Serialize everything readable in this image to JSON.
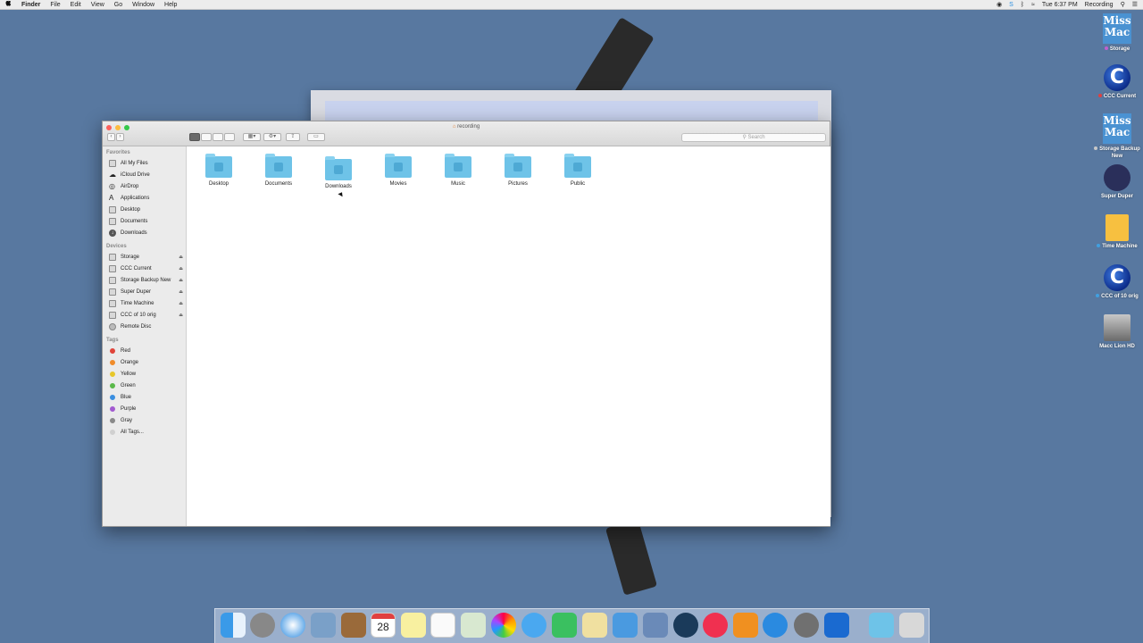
{
  "menubar": {
    "app_name": "Finder",
    "menus": [
      "File",
      "Edit",
      "View",
      "Go",
      "Window",
      "Help"
    ],
    "clock": "Tue 6:37 PM",
    "user": "Recording"
  },
  "window": {
    "title": "recording",
    "search_placeholder": "Search",
    "sidebar": {
      "favorites_header": "Favorites",
      "favorites": [
        "All My Files",
        "iCloud Drive",
        "AirDrop",
        "Applications",
        "Desktop",
        "Documents",
        "Downloads"
      ],
      "devices_header": "Devices",
      "devices": [
        "Storage",
        "CCC Current",
        "Storage Backup New",
        "Super Duper",
        "Time Machine",
        "CCC of 10 orig",
        "Remote Disc"
      ],
      "tags_header": "Tags",
      "tags": [
        {
          "label": "Red",
          "color": "#e0443a"
        },
        {
          "label": "Orange",
          "color": "#f08c2a"
        },
        {
          "label": "Yellow",
          "color": "#e7c72a"
        },
        {
          "label": "Green",
          "color": "#5ab84a"
        },
        {
          "label": "Blue",
          "color": "#3a8ee0"
        },
        {
          "label": "Purple",
          "color": "#a25ad0"
        },
        {
          "label": "Gray",
          "color": "#8a8a8a"
        },
        {
          "label": "All Tags...",
          "color": "#d0d0d0"
        }
      ]
    },
    "folders": [
      "Desktop",
      "Documents",
      "Downloads",
      "Movies",
      "Music",
      "Pictures",
      "Public"
    ]
  },
  "desktop_icons": [
    {
      "label": "Storage",
      "title": "Miss Mac",
      "dot": "#c060d0"
    },
    {
      "label": "CCC Current",
      "dot": "#e04040"
    },
    {
      "label": "Storage Backup New",
      "title": "Miss Mac",
      "dot": "#c8c8c8"
    },
    {
      "label": "Super Duper"
    },
    {
      "label": "Time Machine",
      "dot": "#40a0e0"
    },
    {
      "label": "CCC of 10 orig",
      "dot": "#40a0e0"
    },
    {
      "label": "Macc Lion HD"
    }
  ],
  "dock": {
    "calendar_day": "28"
  }
}
